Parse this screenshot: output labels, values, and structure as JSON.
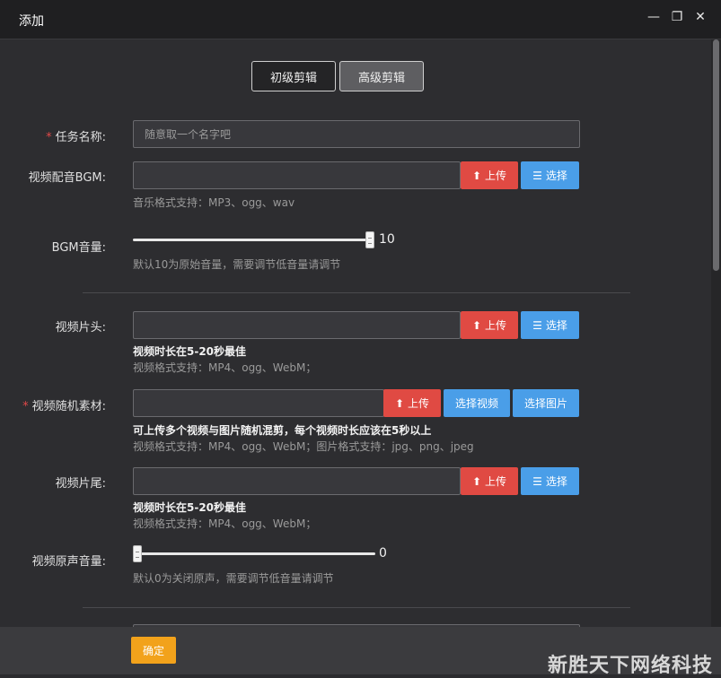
{
  "window": {
    "title": "添加",
    "minimize_icon": "minimize-icon",
    "maximize_icon": "restore-icon",
    "close_icon": "close-icon"
  },
  "tabs": [
    {
      "label": "初级剪辑",
      "active": false
    },
    {
      "label": "高级剪辑",
      "active": true
    }
  ],
  "form": {
    "task_name": {
      "label": "任务名称:",
      "required": true,
      "placeholder": "随意取一个名字吧"
    },
    "bgm": {
      "label": "视频配音BGM:",
      "value": "",
      "upload_label": "上传",
      "select_label": "选择",
      "hint": "音乐格式支持：MP3、ogg、wav"
    },
    "bgm_volume": {
      "label": "BGM音量:",
      "value": "10",
      "level": 1.0,
      "hint": "默认10为原始音量，需要调节低音量请调节"
    },
    "intro": {
      "label": "视频片头:",
      "value": "",
      "upload_label": "上传",
      "select_label": "选择",
      "hint_strong": "视频时长在5-20秒最佳",
      "hint": "视频格式支持：MP4、ogg、WebM；"
    },
    "random_material": {
      "label": "视频随机素材:",
      "required": true,
      "value": "",
      "upload_label": "上传",
      "select_video_label": "选择视频",
      "select_image_label": "选择图片",
      "hint_strong": "可上传多个视频与图片随机混剪，每个视频时长应该在5秒以上",
      "hint": "视频格式支持：MP4、ogg、WebM；图片格式支持：jpg、png、jpeg"
    },
    "outro": {
      "label": "视频片尾:",
      "value": "",
      "upload_label": "上传",
      "select_label": "选择",
      "hint_strong": "视频时长在5-20秒最佳",
      "hint": "视频格式支持：MP4、ogg、WebM；"
    },
    "original_volume": {
      "label": "视频原声音量:",
      "value": "0",
      "level": 0.0,
      "hint": "默认0为关闭原声，需要调节低音量请调节"
    }
  },
  "footer": {
    "ok_label": "确定",
    "watermark": "新胜天下网络科技"
  },
  "colors": {
    "upload": "#e04a43",
    "select": "#4a9ee8",
    "ok": "#f2a21b",
    "required": "#e04848"
  }
}
